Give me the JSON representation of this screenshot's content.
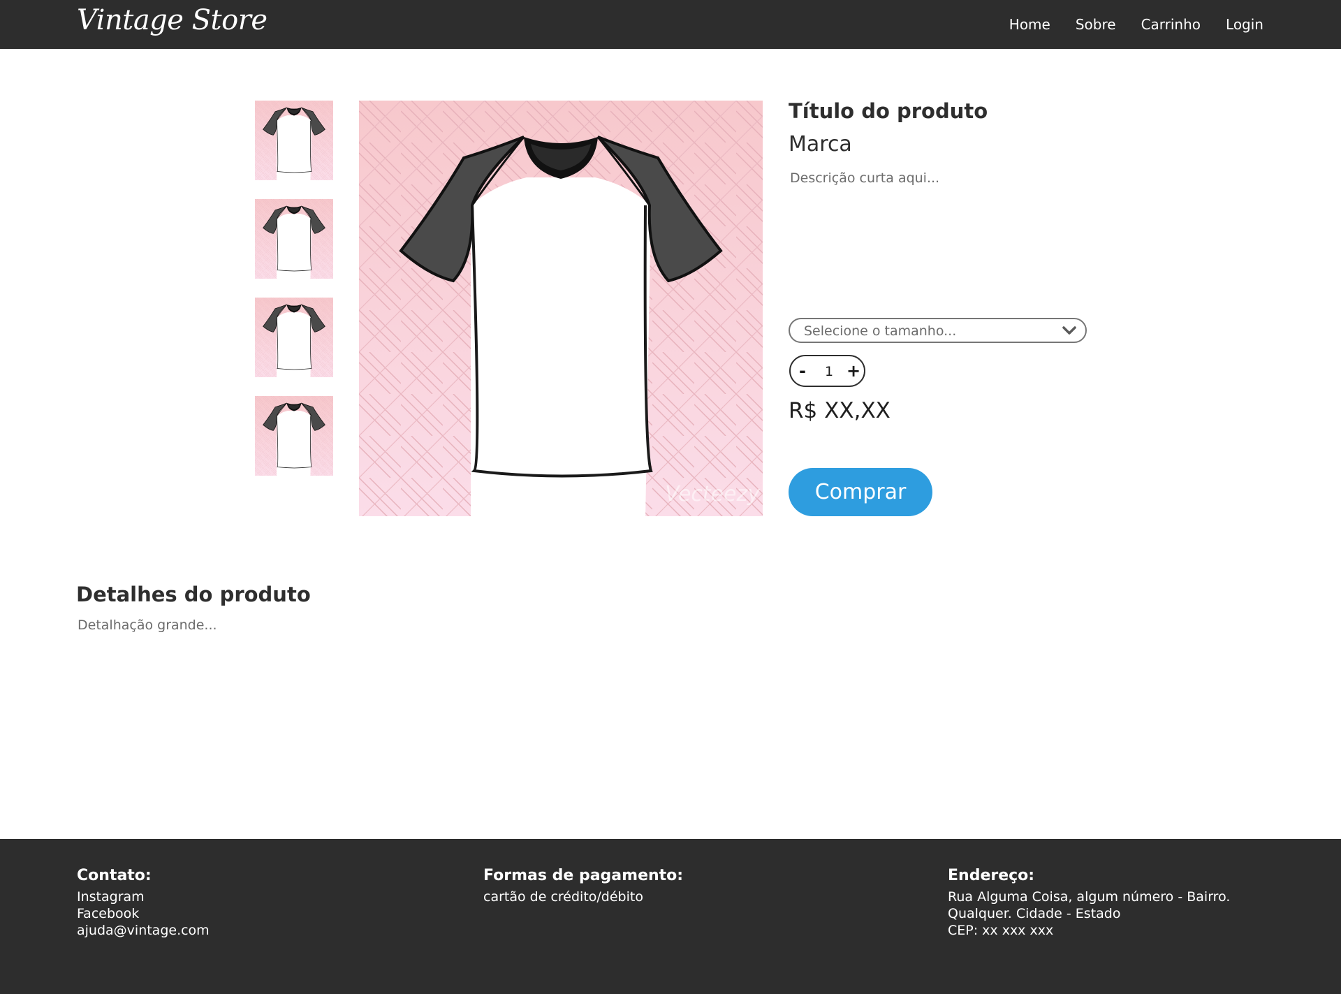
{
  "header": {
    "logo": "Vintage Store",
    "nav": [
      "Home",
      "Sobre",
      "Carrinho",
      "Login"
    ]
  },
  "gallery": {
    "thumbnail_count": 4,
    "watermark": "Vecteezy"
  },
  "product": {
    "title": "Título do produto",
    "brand": "Marca",
    "short_description": "Descrição curta aqui...",
    "size_placeholder": "Selecione o tamanho...",
    "quantity": "1",
    "minus_label": "-",
    "plus_label": "+",
    "price": "R$ XX,XX",
    "buy_label": "Comprar"
  },
  "details": {
    "title": "Detalhes do produto",
    "text": "Detalhação grande..."
  },
  "footer": {
    "contact": {
      "heading": "Contato:",
      "lines": [
        "Instagram",
        "Facebook",
        "ajuda@vintage.com"
      ]
    },
    "payment": {
      "heading": "Formas de pagamento:",
      "lines": [
        "cartão de crédito/débito"
      ]
    },
    "address": {
      "heading": "Endereço:",
      "lines": [
        "Rua Alguma Coisa, algum número - Bairro.",
        "Qualquer. Cidade - Estado",
        "CEP: xx xxx xxx"
      ]
    }
  },
  "colors": {
    "header_bg": "#2d2d2d",
    "footer_bg": "#2d2d2d",
    "accent_button": "#2e9ddf",
    "image_bg_top": "#f7c8cc",
    "image_bg_bottom": "#fbdde9",
    "shirt_sleeve": "#4a4a4a",
    "shirt_body": "#ffffff"
  }
}
